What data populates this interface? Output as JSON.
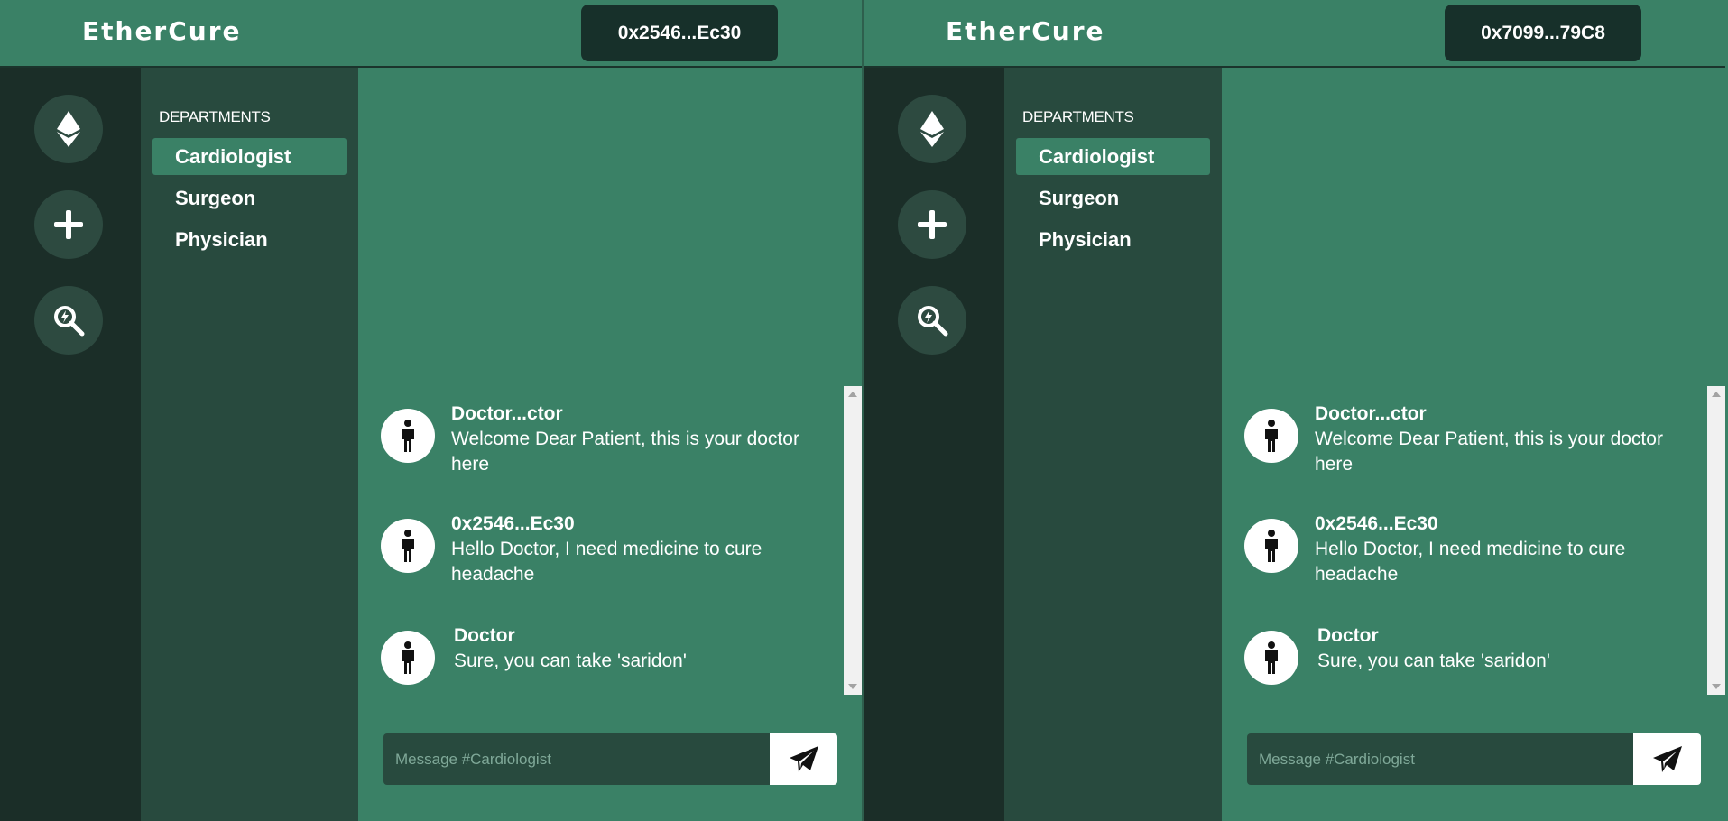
{
  "windows": [
    {
      "brand": "EtherCure",
      "account": "0x2546...Ec30",
      "rail": [
        "ethereum-icon",
        "plus-icon",
        "search-refresh-icon"
      ],
      "departments_title": "DEPARTMENTS",
      "departments": [
        "Cardiologist",
        "Surgeon",
        "Physician"
      ],
      "active_department": "Cardiologist",
      "messages": [
        {
          "sender": "Doctor...ctor",
          "text": "Welcome Dear Patient, this is your doctor here"
        },
        {
          "sender": "0x2546...Ec30",
          "text": "Hello Doctor, I need medicine to cure headache"
        },
        {
          "sender": "Doctor",
          "text": "Sure, you can take 'saridon'"
        }
      ],
      "composer_placeholder": "Message #Cardiologist"
    },
    {
      "brand": "EtherCure",
      "account": "0x7099...79C8",
      "rail": [
        "ethereum-icon",
        "plus-icon",
        "search-refresh-icon"
      ],
      "departments_title": "DEPARTMENTS",
      "departments": [
        "Cardiologist",
        "Surgeon",
        "Physician"
      ],
      "active_department": "Cardiologist",
      "messages": [
        {
          "sender": "Doctor...ctor",
          "text": "Welcome Dear Patient, this is your doctor here"
        },
        {
          "sender": "0x2546...Ec30",
          "text": "Hello Doctor, I need medicine to cure headache"
        },
        {
          "sender": "Doctor",
          "text": "Sure, you can take 'saridon'"
        }
      ],
      "composer_placeholder": "Message #Cardiologist"
    }
  ],
  "colors": {
    "main": "#3a8166",
    "rail": "#1b2e28",
    "sidebar": "#284a3e",
    "account_badge": "#17302a"
  }
}
